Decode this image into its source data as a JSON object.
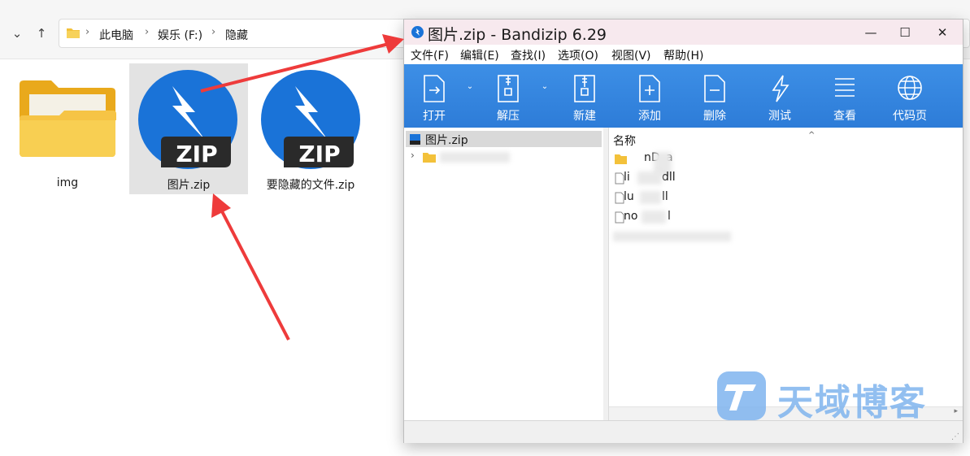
{
  "explorer": {
    "breadcrumb": [
      "此电脑",
      "娱乐 (F:)",
      "隐藏"
    ],
    "files": [
      {
        "name": "img",
        "type": "folder"
      },
      {
        "name": "图片.zip",
        "type": "zip",
        "selected": true
      },
      {
        "name": "要隐藏的文件.zip",
        "type": "zip"
      }
    ],
    "zip_badge": "ZIP"
  },
  "bandizip": {
    "title": "图片.zip - Bandizip 6.29",
    "menus": [
      "文件(F)",
      "编辑(E)",
      "查找(I)",
      "选项(O)",
      "视图(V)",
      "帮助(H)"
    ],
    "toolbar": [
      "打开",
      "解压",
      "新建",
      "添加",
      "删除",
      "测试",
      "查看",
      "代码页"
    ],
    "tree_root": "图片.zip",
    "column_name": "名称",
    "rows": [
      {
        "prefix": "",
        "suffix": "nD",
        "end": "a",
        "icon": "folder"
      },
      {
        "prefix": "li",
        "suffix": "dll",
        "end": "",
        "icon": "file"
      },
      {
        "prefix": "lu",
        "suffix": "ll",
        "end": "",
        "icon": "file"
      },
      {
        "prefix": "no",
        "suffix": "l",
        "end": "",
        "icon": "file"
      }
    ]
  },
  "watermark": "天域博客",
  "colors": {
    "toolbar": "#2d7cd8",
    "zip_blue": "#1a73d8",
    "arrow": "#ee3b3b",
    "title_bg": "#f7e9ee"
  }
}
